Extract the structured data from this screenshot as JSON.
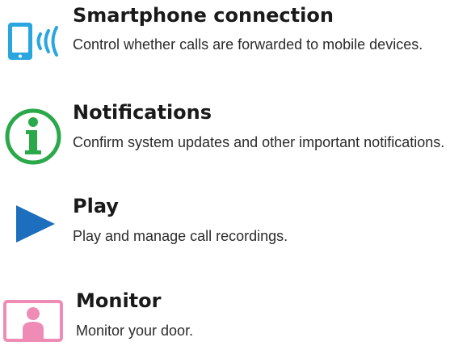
{
  "colors": {
    "phone_blue": "#29a6e0",
    "info_green": "#2ba84a",
    "play_blue": "#1d6fbd",
    "monitor_pink": "#ee8cb6"
  },
  "features": [
    {
      "icon": "smartphone-signal-icon",
      "title": "Smartphone connection",
      "description": "Control whether calls are forwarded to mobile devices."
    },
    {
      "icon": "info-icon",
      "title": "Notifications",
      "description": "Confirm system updates and other important notifications."
    },
    {
      "icon": "play-icon",
      "title": "Play",
      "description": "Play and manage call recordings."
    },
    {
      "icon": "monitor-person-icon",
      "title": "Monitor",
      "description": "Monitor your door."
    }
  ]
}
